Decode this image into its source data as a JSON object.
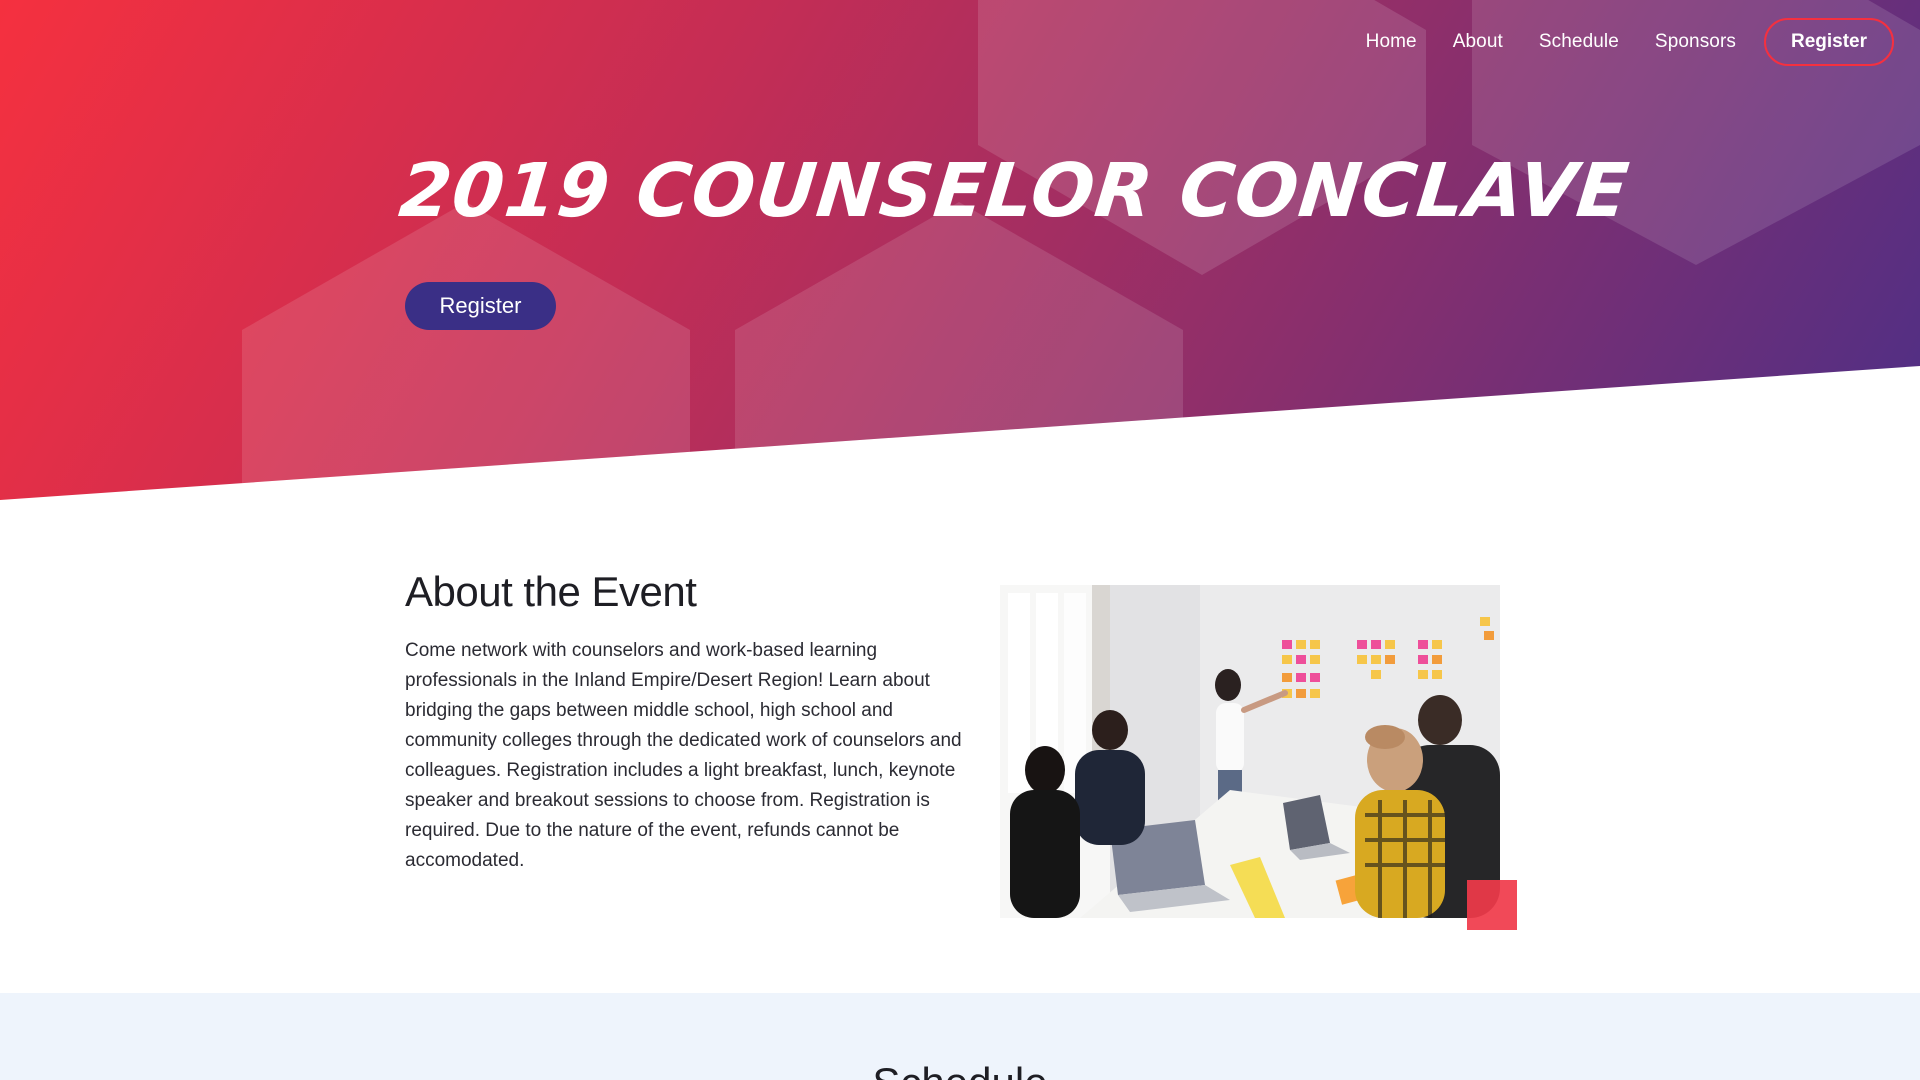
{
  "nav": {
    "items": [
      {
        "label": "Home"
      },
      {
        "label": "About"
      },
      {
        "label": "Schedule"
      },
      {
        "label": "Sponsors"
      }
    ],
    "register_label": "Register"
  },
  "hero": {
    "title": "2019 Counselor Conclave",
    "register_label": "Register"
  },
  "about": {
    "heading": "About the Event",
    "text": "Come network with counselors and work-based learning professionals in the Inland Empire/Desert Region! Learn about bridging the gaps between middle school, high school and community colleges through the dedicated work of counselors and colleagues. Registration includes a light breakfast, lunch, keynote speaker and breakout sessions to choose from. Registration is required. Due to the nature of the event, refunds cannot be accomodated."
  },
  "schedule": {
    "heading": "Schedule"
  },
  "colors": {
    "hero_start": "#f5303f",
    "hero_end": "#4d2f86",
    "hero_button": "#3a2f86",
    "accent": "#f03a4a",
    "schedule_bg": "#eef4fc"
  }
}
